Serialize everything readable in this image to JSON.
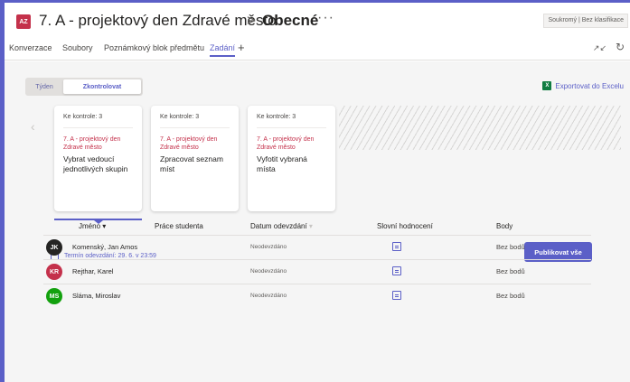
{
  "header": {
    "avatar_initials": "AZ",
    "team_name": "7. A - projektový den Zdravé město",
    "separator": ">",
    "channel_name": "Obecné",
    "more": "···",
    "privacy_badge": "Soukromý | Bez klasifikace"
  },
  "tabs": [
    {
      "label": "Konverzace"
    },
    {
      "label": "Soubory"
    },
    {
      "label": "Poznámkový blok předmětu"
    },
    {
      "label": "Zadání"
    }
  ],
  "tab_add": "+",
  "tab_icons": {
    "expand": "expand-icon",
    "refresh": "refresh-icon"
  },
  "view_toggle": {
    "week": "Týden",
    "review": "Zkontrolovat"
  },
  "export_label": "Exportovat do Excelu",
  "export_icon": "X",
  "carousel": {
    "prev": "‹",
    "next": "›"
  },
  "cards": [
    {
      "status": "Ke kontrole: 3",
      "class": "7. A - projektový den Zdravé město",
      "title": "Vybrat vedoucí jednotlivých skupin"
    },
    {
      "status": "Ke kontrole: 3",
      "class": "7. A - projektový den Zdravé město",
      "title": "Zpracovat seznam míst"
    },
    {
      "status": "Ke kontrole: 3",
      "class": "7. A - projektový den Zdravé město",
      "title": "Vyfotit vybraná místa"
    }
  ],
  "due_label": "Termín odevzdání: 29. 6. v 23:59",
  "publish_label": "Publikovat vše",
  "table": {
    "headers": {
      "name": "Jméno ▾",
      "work": "Práce studenta",
      "date": "Datum odevzdání",
      "feedback": "Slovní hodnocení",
      "points": "Body"
    },
    "rows": [
      {
        "initials": "JK",
        "name": "Komenský, Jan Amos",
        "date": "Neodevzdáno",
        "points": "Bez bodů",
        "color": "#252423"
      },
      {
        "initials": "KR",
        "name": "Rejthar, Karel",
        "date": "Neodevzdáno",
        "points": "Bez bodů",
        "color": "#c4314b"
      },
      {
        "initials": "MS",
        "name": "Sláma, Miroslav",
        "date": "Neodevzdáno",
        "points": "Bez bodů",
        "color": "#13a10e"
      }
    ]
  },
  "colors": {
    "accent": "#5b5fc7",
    "red": "#c4314b",
    "green": "#13a10e",
    "excel": "#107c41"
  }
}
